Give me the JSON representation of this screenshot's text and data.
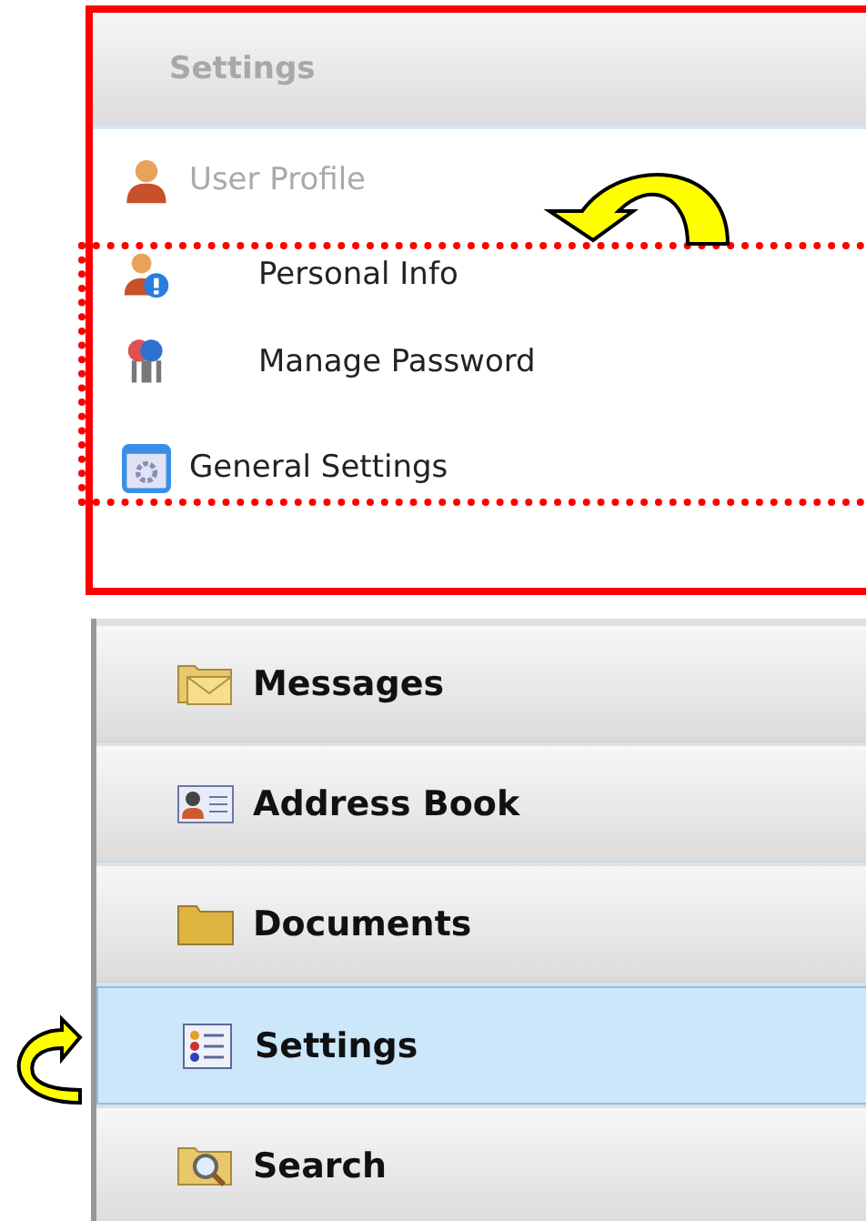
{
  "panel": {
    "title": "Settings",
    "items": [
      {
        "label": "User Profile",
        "kind": "user",
        "disabled": true,
        "children": [
          {
            "label": "Personal Info",
            "kind": "user-info",
            "disabled": false
          },
          {
            "label": "Manage Password",
            "kind": "keys",
            "disabled": false
          }
        ]
      },
      {
        "label": "General Settings",
        "kind": "window",
        "disabled": false
      }
    ]
  },
  "nav": [
    {
      "label": "Messages",
      "kind": "mail",
      "selected": false
    },
    {
      "label": "Address Book",
      "kind": "card",
      "selected": false
    },
    {
      "label": "Documents",
      "kind": "folder",
      "selected": false
    },
    {
      "label": "Settings",
      "kind": "list",
      "selected": true
    },
    {
      "label": "Search",
      "kind": "search",
      "selected": false
    }
  ]
}
